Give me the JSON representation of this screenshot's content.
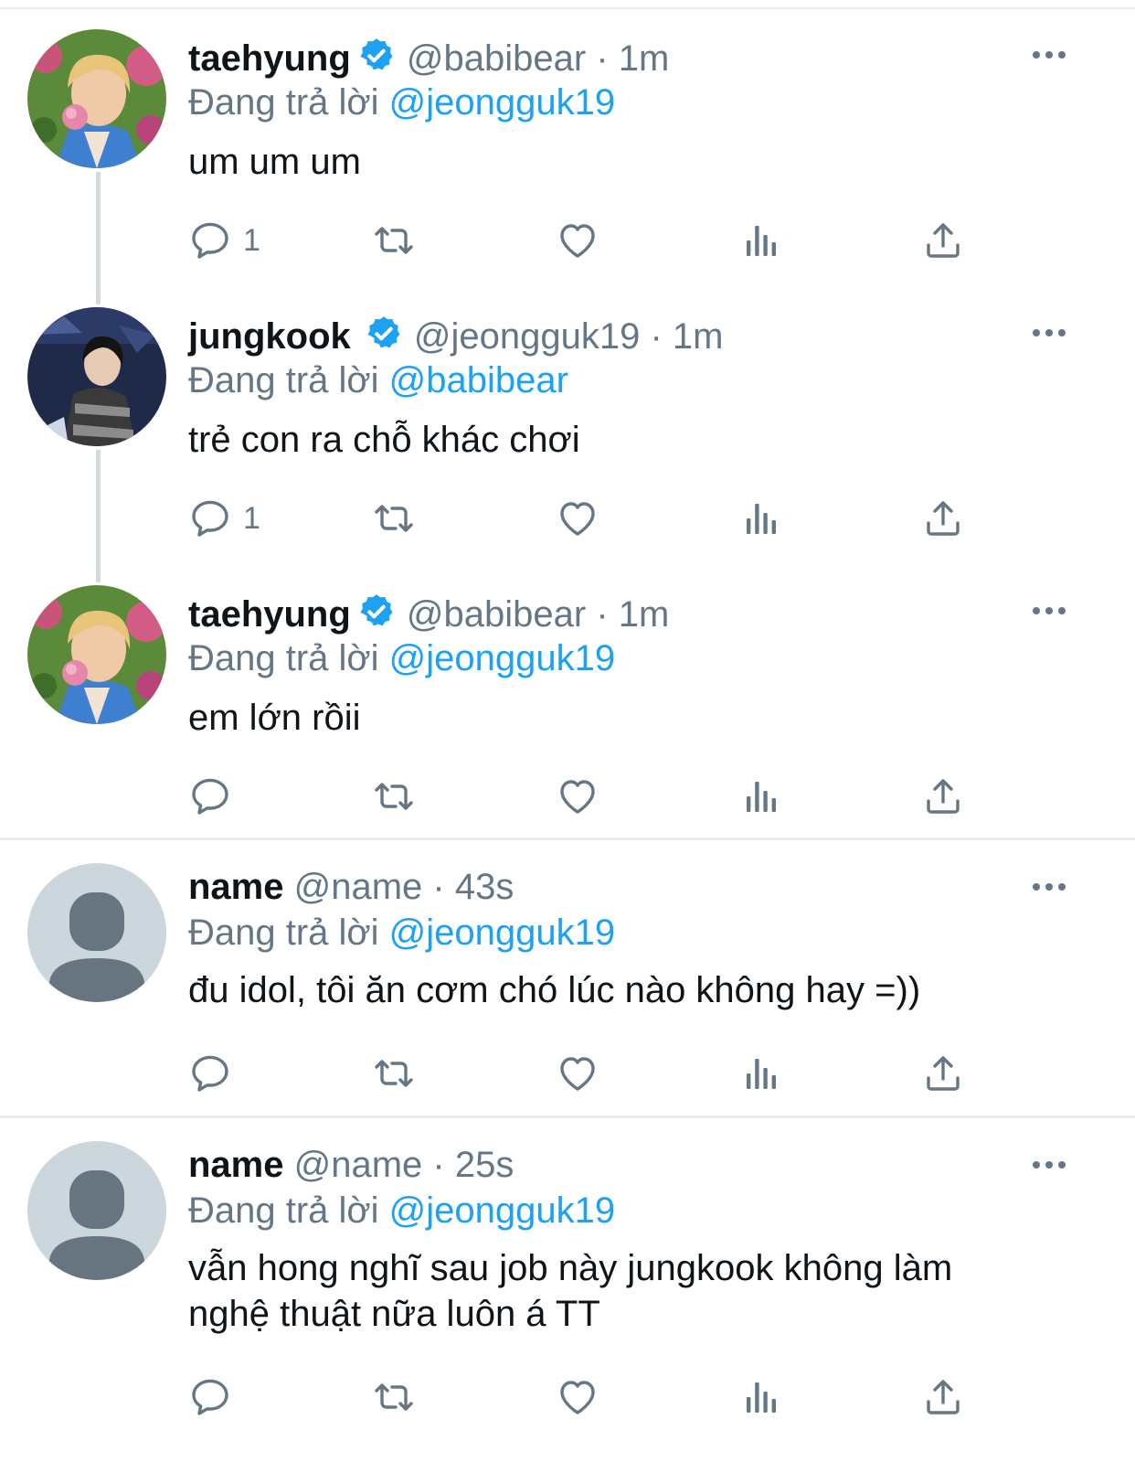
{
  "tweets": [
    {
      "name": "taehyung",
      "verified": true,
      "handle": "@babibear",
      "time": "· 1m",
      "reply_prefix": "Đang trả lời",
      "reply_to": "@jeongguk19",
      "text": "um um um",
      "reply_count": "1",
      "avatar": "taehyung-photo"
    },
    {
      "name": "jungkook",
      "verified": true,
      "handle": "@jeongguk19",
      "time": "· 1m",
      "reply_prefix": "Đang trả lời",
      "reply_to": "@babibear",
      "text": "trẻ con ra chỗ khác chơi",
      "reply_count": "1",
      "avatar": "jungkook-photo"
    },
    {
      "name": "taehyung",
      "verified": true,
      "handle": "@babibear",
      "time": "· 1m",
      "reply_prefix": "Đang trả lời",
      "reply_to": "@jeongguk19",
      "text": "em lớn rồii",
      "reply_count": "",
      "avatar": "taehyung-photo"
    },
    {
      "name": "name",
      "verified": false,
      "handle": "@name",
      "time": "· 43s",
      "reply_prefix": "Đang trả lời",
      "reply_to": "@jeongguk19",
      "text": "đu idol, tôi ăn cơm chó lúc nào không hay =))",
      "reply_count": "",
      "avatar": "default-avatar"
    },
    {
      "name": "name",
      "verified": false,
      "handle": "@name",
      "time": "· 25s",
      "reply_prefix": "Đang trả lời",
      "reply_to": "@jeongguk19",
      "text": "vẫn hong nghĩ sau job này jungkook không làm nghệ thuật nữa luôn á TT",
      "reply_count": "",
      "avatar": "default-avatar"
    }
  ],
  "icons": {
    "reply": "reply-icon",
    "retweet": "retweet-icon",
    "like": "heart-icon",
    "analytics": "analytics-icon",
    "share": "share-icon",
    "more": "more-icon",
    "verified": "verified-badge-icon"
  },
  "colors": {
    "link": "#1da1f2",
    "muted": "#657786",
    "icon": "#657786",
    "separator": "#e6ecf0",
    "thread_line": "#d4d9dd"
  }
}
